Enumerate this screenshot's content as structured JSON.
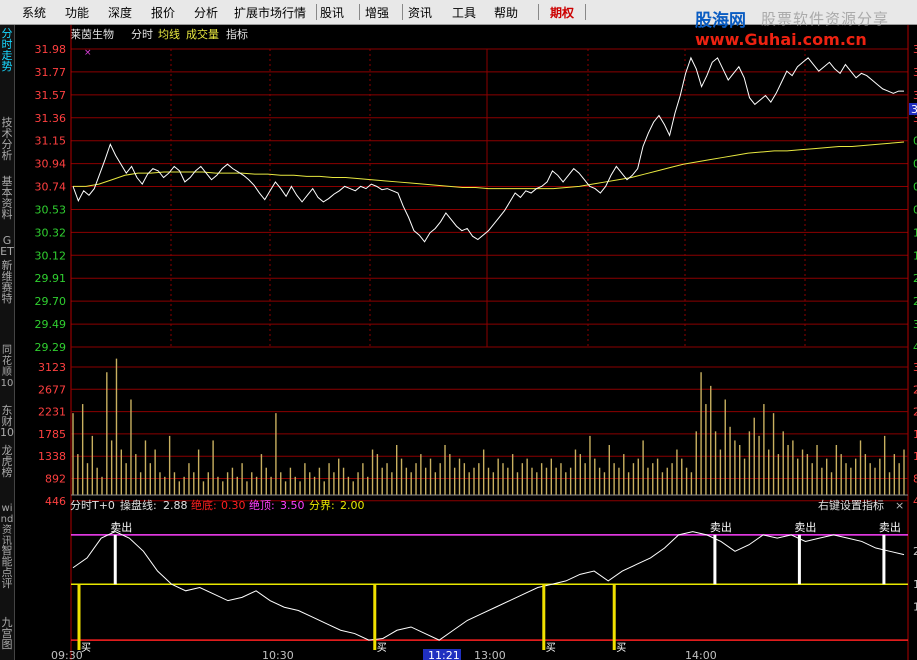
{
  "menu": [
    "系统",
    "功能",
    "深度",
    "报价",
    "分析",
    "扩展市场行情",
    "股讯",
    "增强",
    "资讯",
    "工具",
    "帮助",
    "期权"
  ],
  "logo": {
    "brand": "股海网",
    "slogan": "股票软件资源分享",
    "url": "www.Guhai.com.cn"
  },
  "sidebar_tabs": [
    "分时走势",
    "技术分析",
    "基本资料",
    "GET",
    "新维赛特",
    "同花顺10",
    "东财10",
    "龙虎榜",
    "wind资讯",
    "智能点评",
    "九宫图"
  ],
  "header": {
    "stock": "莱茵生物",
    "mode": "分时",
    "avg": "均线",
    "vol": "成交量",
    "ind": "指标"
  },
  "price_axis": [
    "31.98",
    "31.77",
    "31.57",
    "31.36",
    "31.15",
    "30.94",
    "30.74",
    "30.53",
    "30.32",
    "30.12",
    "29.91",
    "29.70",
    "29.49",
    "29.29"
  ],
  "vol_axis": [
    "3123",
    "2677",
    "2231",
    "1785",
    "1338",
    "892",
    "446"
  ],
  "indicator": {
    "name": "分时T+0",
    "op_label": "操盘线:",
    "op_val": "2.88",
    "bottom_label": "绝底:",
    "bottom_val": "0.30",
    "top_label": "绝顶:",
    "top_val": "3.50",
    "bound_label": "分界:",
    "bound_val": "2.00",
    "settings": "右键设置指标",
    "close": "×",
    "sell": "卖出",
    "buy": "买"
  },
  "time_axis": [
    "09:30",
    "10:30",
    "11:21",
    "13:00",
    "14:00"
  ],
  "right_axis_price": [
    "3",
    "3",
    "3",
    "3",
    "0",
    "0",
    "0",
    "0",
    "1",
    "1",
    "2",
    "2",
    "3",
    "4"
  ],
  "right_axis_vol": [
    "3",
    "2",
    "2",
    "1",
    "1",
    "8",
    "4"
  ],
  "right_axis_ind": [
    "2",
    "1"
  ],
  "right_marker": "3",
  "right_cut_label": "1",
  "colors": {
    "price_line": "#ffffff",
    "avg_line": "#e8e840",
    "grid": "#8b0000",
    "axis_up": "#ff4040",
    "axis_down": "#30d030",
    "volume": "#c8b060",
    "indicator_top": "#ff40ff",
    "indicator_mid": "#e8e800",
    "indicator_bottom": "#ff2020",
    "menu_highlight": "#cc0000"
  },
  "chart_data": {
    "type": "line",
    "price": [
      30.74,
      30.61,
      30.7,
      30.66,
      30.72,
      30.85,
      30.98,
      31.12,
      31.02,
      30.94,
      30.86,
      30.92,
      30.82,
      30.76,
      30.85,
      30.9,
      30.88,
      30.82,
      30.86,
      30.92,
      30.88,
      30.78,
      30.82,
      30.88,
      30.92,
      30.86,
      30.8,
      30.84,
      30.9,
      30.94,
      30.9,
      30.87,
      30.84,
      30.8,
      30.75,
      30.68,
      30.62,
      30.7,
      30.78,
      30.72,
      30.65,
      30.74,
      30.66,
      30.6,
      30.66,
      30.72,
      30.64,
      30.6,
      30.63,
      30.67,
      30.7,
      30.74,
      30.72,
      30.7,
      30.74,
      30.72,
      30.76,
      30.74,
      30.71,
      30.72,
      30.7,
      30.68,
      30.56,
      30.46,
      30.34,
      30.3,
      30.24,
      30.32,
      30.36,
      30.42,
      30.5,
      30.44,
      30.38,
      30.34,
      30.36,
      30.29,
      30.26,
      30.3,
      30.34,
      30.4,
      30.46,
      30.52,
      30.6,
      30.68,
      30.64,
      30.7,
      30.68,
      30.72,
      30.74,
      30.78,
      30.88,
      30.84,
      30.78,
      30.84,
      30.9,
      30.86,
      30.8,
      30.74,
      30.72,
      30.68,
      30.74,
      30.84,
      30.92,
      30.86,
      30.8,
      30.84,
      30.9,
      31.1,
      31.22,
      31.32,
      31.38,
      31.3,
      31.2,
      31.4,
      31.56,
      31.76,
      31.9,
      31.8,
      31.64,
      31.74,
      31.86,
      31.9,
      31.8,
      31.7,
      31.76,
      31.82,
      31.72,
      31.54,
      31.48,
      31.52,
      31.56,
      31.5,
      31.58,
      31.68,
      31.78,
      31.74,
      31.82,
      31.86,
      31.9,
      31.84,
      31.78,
      31.82,
      31.86,
      31.8,
      31.76,
      31.84,
      31.78,
      31.72,
      31.76,
      31.74,
      31.7,
      31.66,
      31.62,
      31.6,
      31.58,
      31.6,
      31.6
    ],
    "avg": [
      30.74,
      30.74,
      30.76,
      30.8,
      30.84,
      30.86,
      30.86,
      30.87,
      30.87,
      30.87,
      30.87,
      30.86,
      30.86,
      30.86,
      30.85,
      30.85,
      30.84,
      30.84,
      30.83,
      30.83,
      30.82,
      30.82,
      30.81,
      30.8,
      30.79,
      30.78,
      30.77,
      30.76,
      30.75,
      30.74,
      30.73,
      30.73,
      30.72,
      30.72,
      30.72,
      30.72,
      30.72,
      30.72,
      30.73,
      30.74,
      30.76,
      30.78,
      30.8,
      30.82,
      30.85,
      30.88,
      30.91,
      30.94,
      30.96,
      30.98,
      31.0,
      31.02,
      31.04,
      31.05,
      31.06,
      31.06,
      31.07,
      31.08,
      31.09,
      31.1,
      31.1,
      31.11,
      31.12,
      31.13,
      31.14
    ],
    "volume": [
      1800,
      900,
      2000,
      700,
      1300,
      600,
      400,
      2700,
      1200,
      3000,
      1000,
      700,
      2100,
      900,
      500,
      1200,
      700,
      1000,
      500,
      400,
      1300,
      500,
      300,
      400,
      700,
      500,
      1000,
      300,
      500,
      1200,
      400,
      300,
      500,
      600,
      400,
      700,
      300,
      500,
      400,
      900,
      600,
      400,
      1800,
      500,
      300,
      600,
      400,
      300,
      700,
      500,
      400,
      600,
      300,
      700,
      500,
      800,
      600,
      400,
      300,
      500,
      700,
      400,
      1000,
      900,
      600,
      700,
      500,
      1100,
      800,
      600,
      500,
      700,
      900,
      600,
      800,
      500,
      700,
      1100,
      900,
      600,
      800,
      700,
      500,
      600,
      700,
      1000,
      600,
      500,
      800,
      700,
      600,
      900,
      500,
      700,
      800,
      600,
      500,
      700,
      600,
      800,
      600,
      700,
      500,
      600,
      1000,
      900,
      700,
      1300,
      800,
      600,
      500,
      1100,
      700,
      600,
      900,
      500,
      700,
      800,
      1200,
      600,
      700,
      800,
      500,
      600,
      700,
      1000,
      800,
      600,
      500,
      1400,
      2700,
      2000,
      2400,
      1400,
      1000,
      2100,
      1500,
      1200,
      1100,
      800,
      1400,
      1700,
      1300,
      2000,
      1000,
      1800,
      900,
      1400,
      1100,
      1200,
      800,
      1000,
      900,
      700,
      1100,
      600,
      800,
      500,
      1100,
      900,
      700,
      600,
      800,
      1200,
      900,
      700,
      600,
      800,
      1300,
      500,
      900,
      700,
      1000
    ],
    "indicator": [
      2.5,
      2.8,
      3.4,
      3.6,
      3.4,
      3.0,
      2.4,
      2.0,
      1.8,
      1.9,
      1.7,
      1.5,
      1.6,
      1.8,
      1.5,
      1.3,
      1.2,
      1.0,
      0.8,
      0.6,
      0.5,
      0.3,
      0.35,
      0.6,
      0.7,
      0.5,
      0.3,
      0.6,
      0.9,
      1.1,
      1.3,
      1.5,
      1.7,
      1.9,
      2.0,
      2.1,
      2.3,
      2.4,
      2.1,
      2.4,
      2.6,
      2.8,
      3.1,
      3.5,
      3.6,
      3.5,
      3.3,
      3.0,
      3.2,
      3.5,
      3.4,
      3.5,
      3.3,
      3.4,
      3.5,
      3.4,
      3.3,
      3.1,
      3.0,
      2.9
    ],
    "ylim_price": [
      29.29,
      31.98
    ],
    "ylim_volume": [
      0,
      3123
    ],
    "ylim_indicator": [
      0,
      3.8
    ],
    "x_ticks": [
      "09:30",
      "10:30",
      "11:21",
      "13:00",
      "14:00"
    ]
  }
}
